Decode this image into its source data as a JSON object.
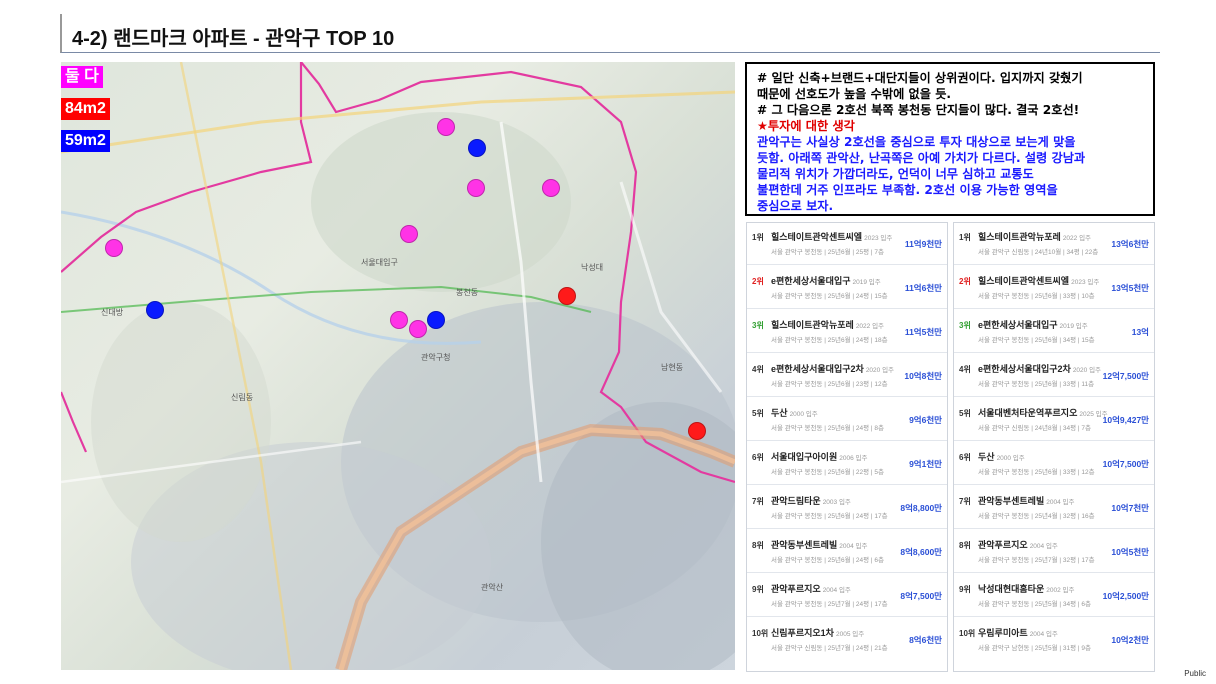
{
  "header": {
    "title": "4-2) 랜드마크 아파트 - 관악구 TOP 10"
  },
  "legend": {
    "items": [
      {
        "label": "둘 다",
        "color": "#ff00ff"
      },
      {
        "label": "84m2",
        "color": "#ff0000"
      },
      {
        "label": "59m2",
        "color": "#0000ff"
      }
    ]
  },
  "map_markers": {
    "colors": {
      "both": "#ff33e6",
      "m84": "#ff1a1a",
      "m59": "#0a1aff"
    },
    "place_labels": [
      "봉천동",
      "신림동",
      "관악산",
      "서울대입구",
      "낙성대",
      "신대방",
      "남현동",
      "관악구청"
    ]
  },
  "note": {
    "line1": "# 일단 신축+브랜드+대단지들이 상위권이다. 입지까지 갖췄기",
    "line2": "때문에 선호도가 높을 수밖에 없을 듯.",
    "line3": "# 그 다음으론 2호선 북쪽 봉천동 단지들이 많다. 결국 2호선!",
    "heading": "★투자에 대한 생각",
    "line5": "관악구는 사실상 2호선을 중심으로 투자 대상으로 보는게 맞을",
    "line6": "듯함. 아래쪽 관악산, 난곡쪽은 아예 가치가 다르다. 설령 강남과",
    "line7": "물리적 위치가 가깝더라도, 언덕이 너무 심하고 교통도",
    "line8": "불편한데 거주 인프라도 부족함. 2호선 이용 가능한 영역을",
    "line9": "중심으로 보자."
  },
  "ranking_left": [
    {
      "rank": "1위",
      "name": "힐스테이트관악센트씨엘",
      "year": "2023 입주",
      "sub": "서울 관악구 봉천동 | 25년6월 | 25평 | 7층",
      "price": "11억9천만",
      "rank_color": "default"
    },
    {
      "rank": "2위",
      "name": "e편한세상서울대입구",
      "year": "2019 입주",
      "sub": "서울 관악구 봉천동 | 25년6월 | 24평 | 15층",
      "price": "11억6천만",
      "rank_color": "red"
    },
    {
      "rank": "3위",
      "name": "힐스테이트관악뉴포레",
      "year": "2022 입주",
      "sub": "서울 관악구 봉천동 | 25년6월 | 24평 | 18층",
      "price": "11억5천만",
      "rank_color": "green"
    },
    {
      "rank": "4위",
      "name": "e편한세상서울대입구2차",
      "year": "2020 입주",
      "sub": "서울 관악구 봉천동 | 25년6월 | 23평 | 12층",
      "price": "10억8천만",
      "rank_color": "default"
    },
    {
      "rank": "5위",
      "name": "두산",
      "year": "2000 입주",
      "sub": "서울 관악구 봉천동 | 25년6월 | 24평 | 8층",
      "price": "9억6천만",
      "rank_color": "default"
    },
    {
      "rank": "6위",
      "name": "서울대입구아이원",
      "year": "2006 입주",
      "sub": "서울 관악구 봉천동 | 25년6월 | 22평 | 5층",
      "price": "9억1천만",
      "rank_color": "default"
    },
    {
      "rank": "7위",
      "name": "관악드림타운",
      "year": "2003 입주",
      "sub": "서울 관악구 봉천동 | 25년6월 | 24평 | 17층",
      "price": "8억8,800만",
      "rank_color": "default"
    },
    {
      "rank": "8위",
      "name": "관악동부센트레빌",
      "year": "2004 입주",
      "sub": "서울 관악구 봉천동 | 25년6월 | 24평 | 6층",
      "price": "8억8,600만",
      "rank_color": "default"
    },
    {
      "rank": "9위",
      "name": "관악푸르지오",
      "year": "2004 입주",
      "sub": "서울 관악구 봉천동 | 25년7월 | 24평 | 17층",
      "price": "8억7,500만",
      "rank_color": "default"
    },
    {
      "rank": "10위",
      "name": "신림푸르지오1차",
      "year": "2005 입주",
      "sub": "서울 관악구 신림동 | 25년7월 | 24평 | 21층",
      "price": "8억6천만",
      "rank_color": "default"
    }
  ],
  "ranking_right": [
    {
      "rank": "1위",
      "name": "힐스테이트관악뉴포레",
      "year": "2022 입주",
      "sub": "서울 관악구 신림동 | 24년10월 | 34평 | 22층",
      "price": "13억6천만",
      "rank_color": "default"
    },
    {
      "rank": "2위",
      "name": "힐스테이트관악센트씨엘",
      "year": "2023 입주",
      "sub": "서울 관악구 봉천동 | 25년6월 | 33평 | 10층",
      "price": "13억5천만",
      "rank_color": "red"
    },
    {
      "rank": "3위",
      "name": "e편한세상서울대입구",
      "year": "2019 입주",
      "sub": "서울 관악구 봉천동 | 25년6월 | 34평 | 15층",
      "price": "13억",
      "rank_color": "green"
    },
    {
      "rank": "4위",
      "name": "e편한세상서울대입구2차",
      "year": "2020 입주",
      "sub": "서울 관악구 봉천동 | 25년6월 | 33평 | 11층",
      "price": "12억7,500만",
      "rank_color": "default"
    },
    {
      "rank": "5위",
      "name": "서울대벤처타운역푸르지오",
      "year": "2025 입주",
      "sub": "서울 관악구 신림동 | 24년8월 | 34평 | 7층",
      "price": "10억9,427만",
      "rank_color": "default"
    },
    {
      "rank": "6위",
      "name": "두산",
      "year": "2000 입주",
      "sub": "서울 관악구 봉천동 | 25년6월 | 33평 | 12층",
      "price": "10억7,500만",
      "rank_color": "default"
    },
    {
      "rank": "7위",
      "name": "관악동부센트레빌",
      "year": "2004 입주",
      "sub": "서울 관악구 봉천동 | 25년4월 | 32평 | 16층",
      "price": "10억7천만",
      "rank_color": "default"
    },
    {
      "rank": "8위",
      "name": "관악푸르지오",
      "year": "2004 입주",
      "sub": "서울 관악구 봉천동 | 25년7월 | 32평 | 17층",
      "price": "10억5천만",
      "rank_color": "default"
    },
    {
      "rank": "9위",
      "name": "낙성대현대홈타운",
      "year": "2002 입주",
      "sub": "서울 관악구 봉천동 | 25년5월 | 34평 | 6층",
      "price": "10억2,500만",
      "rank_color": "default"
    },
    {
      "rank": "10위",
      "name": "우림루미아트",
      "year": "2004 입주",
      "sub": "서울 관악구 남현동 | 25년5월 | 31평 | 9층",
      "price": "10억2천만",
      "rank_color": "default"
    }
  ],
  "footer": {
    "classification": "Public"
  }
}
